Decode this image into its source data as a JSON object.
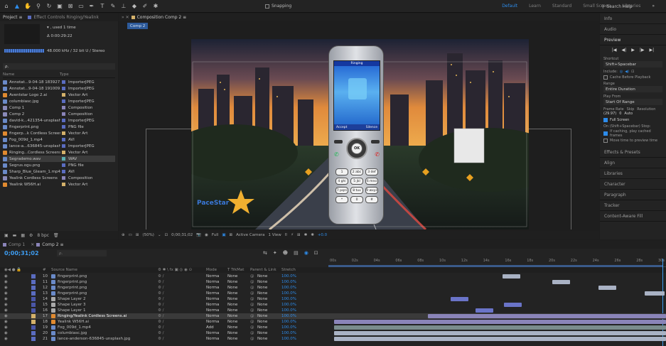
{
  "toolbar": {
    "snapping": "Snapping",
    "workspaces": [
      "Default",
      "Learn",
      "Standard",
      "Small Screen",
      "Libraries"
    ],
    "search_placeholder": "Search Help"
  },
  "project": {
    "tab": "Project",
    "effect_tab": "Effect Controls Ringing/Yealink",
    "used": "▾ , used 1 time",
    "duration": "Δ 0:00:29:22",
    "audio_info": "48.000 kHz / 32 bit U / Stereo",
    "search_glyph": "ρ.",
    "col_name": "Name",
    "col_type": "Type",
    "items": [
      {
        "name": "Annotat...9-04-18 183927.jpg",
        "type": "ImporterJPEG",
        "icon": "image-file-icon"
      },
      {
        "name": "Annotat...9-04-18 191009.jpg",
        "type": "ImporterJPEG",
        "icon": "image-file-icon"
      },
      {
        "name": "Aventstar Logo 2.ai",
        "type": "Vector Art",
        "icon": "vector-file-icon"
      },
      {
        "name": "columbiasc.jpg",
        "type": "ImporterJPEG",
        "icon": "image-file-icon"
      },
      {
        "name": "Comp 1",
        "type": "Composition",
        "icon": "composition-icon"
      },
      {
        "name": "Comp 2",
        "type": "Composition",
        "icon": "composition-icon"
      },
      {
        "name": "david-k...421354-unsplash.jpg",
        "type": "ImporterJPEG",
        "icon": "image-file-icon"
      },
      {
        "name": "fingerprint.png",
        "type": "PNG file",
        "icon": "image-file-icon"
      },
      {
        "name": "fingerp...k Cordless Screens.ai",
        "type": "Vector Art",
        "icon": "vector-file-icon"
      },
      {
        "name": "Fog_009d_1.mp4",
        "type": "AVI",
        "icon": "video-file-icon"
      },
      {
        "name": "lance-a...636845-unsplash.jpg",
        "type": "ImporterJPEG",
        "icon": "image-file-icon"
      },
      {
        "name": "Ringing...Cordless Screens.ai",
        "type": "Vector Art",
        "icon": "vector-file-icon"
      },
      {
        "name": "Segrademo.wav",
        "type": "WAV",
        "icon": "audio-file-icon"
      },
      {
        "name": "Segrus.ogu.png",
        "type": "PNG file",
        "icon": "image-file-icon"
      },
      {
        "name": "Sharp_Blue_Gleam_1.mp4",
        "type": "AVI",
        "icon": "video-file-icon"
      },
      {
        "name": "Yealink Cordless Screens",
        "type": "Composition",
        "icon": "composition-icon"
      },
      {
        "name": "Yealink W56H.ai",
        "type": "Vector Art",
        "icon": "vector-file-icon"
      }
    ],
    "bpc": "8 bpc"
  },
  "composition": {
    "tab": "Composition Comp 2",
    "crumb": "Comp 2",
    "zoom": "(50%)",
    "timecode": "0;00;31;02",
    "resolution": "Full",
    "camera": "Active Camera",
    "views": "1 View",
    "exposure": "+0.0",
    "brand_text": "PaceStar"
  },
  "phone": {
    "status": "Ringing",
    "accept": "Accept",
    "silence": "Silence",
    "ok": "OK",
    "keys": [
      "1",
      "2 abc",
      "3 def",
      "4 ghi",
      "5 jkl",
      "6 mno",
      "7 pqrs",
      "8 tuv",
      "9 wxyz",
      "*",
      "0",
      "#"
    ]
  },
  "right_panel": {
    "info": "Info",
    "audio": "Audio",
    "preview": "Preview",
    "shortcut_label": "Shortcut",
    "shortcut_value": "Shift+Spacebar",
    "include_label": "Include:",
    "cache_label": "Cache Before Playback",
    "range_label": "Range",
    "range_value": "Entire Duration",
    "play_from_label": "Play From",
    "play_from_value": "Start Of Range",
    "frame_rate_label": "Frame Rate",
    "skip_label": "Skip",
    "resolution_label": "Resolution",
    "frame_rate_value": "(29.97)",
    "skip_value": "0",
    "resolution_value": "Auto",
    "full_screen": "Full Screen",
    "stop_label": "On (Shift+Spacebar) Stop:",
    "cached_frames": "If caching, play cached frames",
    "move_time": "Move time to preview time",
    "panels": [
      "Effects & Presets",
      "Align",
      "Libraries",
      "Character",
      "Paragraph",
      "Tracker",
      "Content-Aware Fill"
    ]
  },
  "timeline": {
    "tabs": [
      "Comp 1",
      "Comp 2"
    ],
    "timecode": "0;00;31;02",
    "col_source": "Source Name",
    "col_mode": "Mode",
    "col_trkmat": "T  TrkMat",
    "col_parent": "Parent & Link",
    "col_stretch": "Stretch",
    "ruler": [
      "00s",
      "02s",
      "04s",
      "06s",
      "08s",
      "10s",
      "12s",
      "14s",
      "16s",
      "18s",
      "20s",
      "22s",
      "24s",
      "26s",
      "28s",
      "30s"
    ],
    "layers": [
      {
        "num": "10",
        "name": "fingerprint.png",
        "mode": "Norma",
        "trkmat": "None",
        "parent": "None",
        "stretch": "100.0%",
        "label": "#5a6cc0",
        "icon": "image-file-icon"
      },
      {
        "num": "11",
        "name": "fingerprint.png",
        "mode": "Norma",
        "trkmat": "None",
        "parent": "None",
        "stretch": "100.0%",
        "label": "#5a6cc0",
        "icon": "image-file-icon"
      },
      {
        "num": "12",
        "name": "fingerprint.png",
        "mode": "Norma",
        "trkmat": "None",
        "parent": "None",
        "stretch": "100.0%",
        "label": "#5a6cc0",
        "icon": "image-file-icon"
      },
      {
        "num": "13",
        "name": "fingerprint.png",
        "mode": "Norma",
        "trkmat": "None",
        "parent": "None",
        "stretch": "100.0%",
        "label": "#5a6cc0",
        "icon": "image-file-icon"
      },
      {
        "num": "14",
        "name": "Shape Layer 2",
        "mode": "Norma",
        "trkmat": "None",
        "parent": "None",
        "stretch": "100.0%",
        "label": "#4a56a8",
        "icon": "shape-layer-icon"
      },
      {
        "num": "15",
        "name": "Shape Layer 3",
        "mode": "Norma",
        "trkmat": "None",
        "parent": "None",
        "stretch": "100.0%",
        "label": "#4a56a8",
        "icon": "shape-layer-icon"
      },
      {
        "num": "16",
        "name": "Shape Layer 1",
        "mode": "Norma",
        "trkmat": "None",
        "parent": "None",
        "stretch": "100.0%",
        "label": "#4a56a8",
        "icon": "shape-layer-icon"
      },
      {
        "num": "17",
        "name": "Ringing/Yealink Cordless Screens.ai",
        "mode": "Norma",
        "trkmat": "None",
        "parent": "None",
        "stretch": "100.0%",
        "label": "#d4b16a",
        "icon": "vector-file-icon"
      },
      {
        "num": "18",
        "name": "Yealink W56H.ai",
        "mode": "Norma",
        "trkmat": "None",
        "parent": "None",
        "stretch": "100.0%",
        "label": "#d4b16a",
        "icon": "vector-file-icon"
      },
      {
        "num": "19",
        "name": "Fog_009d_1.mp4",
        "mode": "Add",
        "trkmat": "None",
        "parent": "None",
        "stretch": "100.0%",
        "label": "#4a56a8",
        "icon": "video-file-icon"
      },
      {
        "num": "20",
        "name": "columbiasc.jpg",
        "mode": "Norma",
        "trkmat": "None",
        "parent": "None",
        "stretch": "100.0%",
        "label": "#5a6cc0",
        "icon": "image-file-icon"
      },
      {
        "num": "21",
        "name": "lance-anderson-636845-unsplash.jpg",
        "mode": "Norma",
        "trkmat": "None",
        "parent": "None",
        "stretch": "100.0%",
        "label": "#5a6cc0",
        "icon": "image-file-icon"
      }
    ]
  },
  "colors": {
    "accent": "#2d8ceb",
    "timecode": "#3d9cf0",
    "bar_blue": "#6a74c8",
    "bar_purple": "#8a84b8",
    "bar_gray": "#7a8c8c",
    "bar_light": "#a9b2c4"
  }
}
